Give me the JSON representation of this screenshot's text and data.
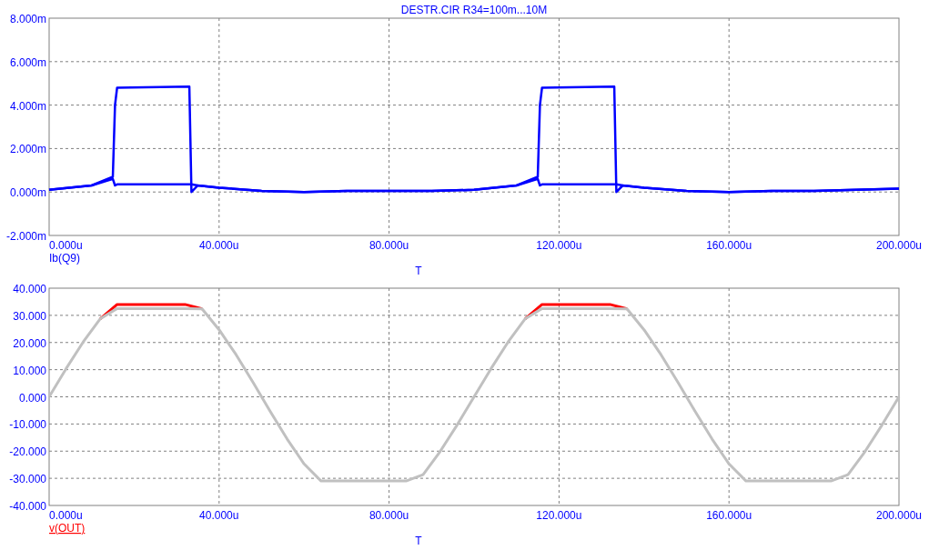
{
  "plots": [
    {
      "title": "DESTR.CIR R34=100m...10M",
      "trace_label": {
        "text": "Ib(Q9)",
        "color": "#0000ff",
        "selected": false
      },
      "chart_data": {
        "type": "line",
        "xlabel": "T",
        "grid": true,
        "x": [
          0,
          10,
          15,
          15.5,
          16,
          33,
          33.5,
          35,
          40,
          50,
          60,
          70,
          80,
          90,
          100,
          110,
          115,
          115.5,
          116,
          133,
          133.5,
          135,
          140,
          150,
          160,
          170,
          180,
          190,
          200
        ],
        "series": [
          {
            "color": "#0000ff",
            "values": [
              0.1,
              0.3,
              0.7,
              4.0,
              4.8,
              4.85,
              0.0,
              0.3,
              0.2,
              0.05,
              0,
              0.05,
              0.05,
              0.05,
              0.1,
              0.3,
              0.7,
              4.0,
              4.8,
              4.85,
              0,
              0.3,
              0.2,
              0.05,
              0,
              0.05,
              0.05,
              0.1,
              0.15
            ]
          },
          {
            "color": "#0000ff",
            "values": [
              0.1,
              0.3,
              0.6,
              0.3,
              0.35,
              0.35,
              0.35,
              0.3,
              0.2,
              0.05,
              0,
              0.05,
              0.05,
              0.05,
              0.1,
              0.3,
              0.6,
              0.3,
              0.35,
              0.35,
              0.35,
              0.3,
              0.2,
              0.05,
              0,
              0.05,
              0.05,
              0.1,
              0.15
            ]
          }
        ],
        "xlim": [
          0,
          200
        ],
        "ylim": [
          -2,
          8
        ],
        "xticks": [
          {
            "value": 0,
            "label": "0.000u"
          },
          {
            "value": 40,
            "label": "40.000u"
          },
          {
            "value": 80,
            "label": "80.000u"
          },
          {
            "value": 120,
            "label": "120.000u"
          },
          {
            "value": 160,
            "label": "160.000u"
          },
          {
            "value": 200,
            "label": "200.000u"
          }
        ],
        "yticks": [
          {
            "value": 8,
            "label": "8.000m"
          },
          {
            "value": 6,
            "label": "6.000m"
          },
          {
            "value": 4,
            "label": "4.000m"
          },
          {
            "value": 2,
            "label": "2.000m"
          },
          {
            "value": 0,
            "label": "0.000m"
          },
          {
            "value": -2,
            "label": "-2.000m"
          }
        ]
      }
    },
    {
      "trace_label": {
        "text": "v(OUT)",
        "color": "#ff0000",
        "selected": true
      },
      "chart_data": {
        "type": "line",
        "xlabel": "T",
        "grid": true,
        "x": [
          0,
          4,
          8,
          12,
          16,
          20,
          24,
          28,
          32,
          36,
          40,
          44,
          48,
          52,
          56,
          60,
          64,
          68,
          72,
          76,
          80,
          84,
          88,
          92,
          96,
          100,
          104,
          108,
          112,
          116,
          120,
          124,
          128,
          132,
          136,
          140,
          144,
          148,
          152,
          156,
          160,
          164,
          168,
          172,
          176,
          180,
          184,
          188,
          192,
          196,
          200
        ],
        "series": [
          {
            "color": "#ff0000",
            "values": [
              null,
              null,
              null,
              28.7,
              34,
              34,
              34,
              34,
              34,
              32.4,
              null,
              null,
              null,
              null,
              null,
              null,
              null,
              null,
              null,
              null,
              null,
              null,
              null,
              null,
              null,
              null,
              null,
              null,
              28.7,
              34,
              34,
              34,
              34,
              34,
              32.4,
              null,
              null,
              null,
              null,
              null,
              null,
              null,
              null,
              null,
              null,
              null,
              null,
              null,
              null,
              null,
              null
            ]
          },
          {
            "color": "#c0c0c0",
            "values": [
              0,
              10.4,
              20.2,
              28.7,
              32.5,
              32.5,
              32.5,
              32.5,
              32.5,
              32.4,
              24.7,
              15.5,
              5.3,
              -5.3,
              -15.5,
              -24.7,
              -31,
              -31,
              -31,
              -31,
              -31,
              -31,
              -28.7,
              -20.2,
              -10.4,
              0,
              10.4,
              20.2,
              28.7,
              32.5,
              32.5,
              32.5,
              32.5,
              32.5,
              32.4,
              24.7,
              15.5,
              5.3,
              -5.3,
              -15.5,
              -24.7,
              -31,
              -31,
              -31,
              -31,
              -31,
              -31,
              -28.7,
              -20.2,
              -10.4,
              0
            ]
          }
        ],
        "xlim": [
          0,
          200
        ],
        "ylim": [
          -40,
          40
        ],
        "xticks": [
          {
            "value": 0,
            "label": "0.000u"
          },
          {
            "value": 40,
            "label": "40.000u"
          },
          {
            "value": 80,
            "label": "80.000u"
          },
          {
            "value": 120,
            "label": "120.000u"
          },
          {
            "value": 160,
            "label": "160.000u"
          },
          {
            "value": 200,
            "label": "200.000u"
          }
        ],
        "yticks": [
          {
            "value": 40,
            "label": "40.000"
          },
          {
            "value": 30,
            "label": "30.000"
          },
          {
            "value": 20,
            "label": "20.000"
          },
          {
            "value": 10,
            "label": "10.000"
          },
          {
            "value": 0,
            "label": "0.000"
          },
          {
            "value": -10,
            "label": "-10.000"
          },
          {
            "value": -20,
            "label": "-20.000"
          },
          {
            "value": -30,
            "label": "-30.000"
          },
          {
            "value": -40,
            "label": "-40.000"
          }
        ]
      }
    }
  ]
}
